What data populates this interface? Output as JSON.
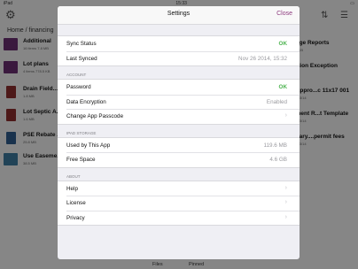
{
  "status_bar": {
    "time": "15:33",
    "left": "iPad"
  },
  "background": {
    "breadcrumb": "Home  /  financing",
    "left_files": [
      {
        "name": "Additional",
        "meta": "16 items 7.8 MB",
        "color": "#6b2f72"
      },
      {
        "name": "Lot plans",
        "meta": "4 items 778.5 KB",
        "color": "#6b2f72"
      },
      {
        "name": "Drain Field...",
        "meta": "1.8 MB",
        "color": "#8c2f2f"
      },
      {
        "name": "Lot Septic A...",
        "meta": "1.6 MB",
        "color": "#8c2f2f"
      },
      {
        "name": "PSE Rebate ...",
        "meta": "25.8 MB",
        "color": "#2f5c8c"
      },
      {
        "name": "Use Easeme...",
        "meta": "38.5 MB",
        "color": "#3c7a9e"
      }
    ],
    "right_files": [
      {
        "name": "nage Reports",
        "meta": "4.3 KB"
      },
      {
        "name": "ration Exception",
        "meta": ""
      },
      {
        "name": "t Appro...c 11x17 001",
        "meta": "10/13/14"
      },
      {
        "name": "ement R...t Template",
        "meta": "10/13/14"
      },
      {
        "name": "imary....permit fees",
        "meta": "10/13/14"
      }
    ],
    "tabs": [
      "Files",
      "Pinned"
    ]
  },
  "settings": {
    "title": "Settings",
    "close_label": "Close",
    "accent_color": "#8e3b7e",
    "ok_color": "#4cb34f",
    "sync": [
      {
        "label": "Sync Status",
        "value": "OK",
        "kind": "ok"
      },
      {
        "label": "Last Synced",
        "value": "Nov 26 2014, 15:32",
        "kind": "value"
      }
    ],
    "account": {
      "header": "ACCOUNT",
      "rows": [
        {
          "label": "Password",
          "value": "OK",
          "kind": "ok"
        },
        {
          "label": "Data Encryption",
          "value": "Enabled",
          "kind": "value"
        },
        {
          "label": "Change App Passcode",
          "value": "",
          "kind": "chevron"
        }
      ]
    },
    "storage": {
      "header": "IPAD STORAGE",
      "rows": [
        {
          "label": "Used by This App",
          "value": "119.6 MB",
          "kind": "value"
        },
        {
          "label": "Free Space",
          "value": "4.6 GB",
          "kind": "value"
        }
      ]
    },
    "about": {
      "header": "ABOUT",
      "rows": [
        {
          "label": "Help",
          "value": "",
          "kind": "chevron"
        },
        {
          "label": "License",
          "value": "",
          "kind": "chevron"
        },
        {
          "label": "Privacy",
          "value": "",
          "kind": "chevron"
        }
      ]
    }
  }
}
